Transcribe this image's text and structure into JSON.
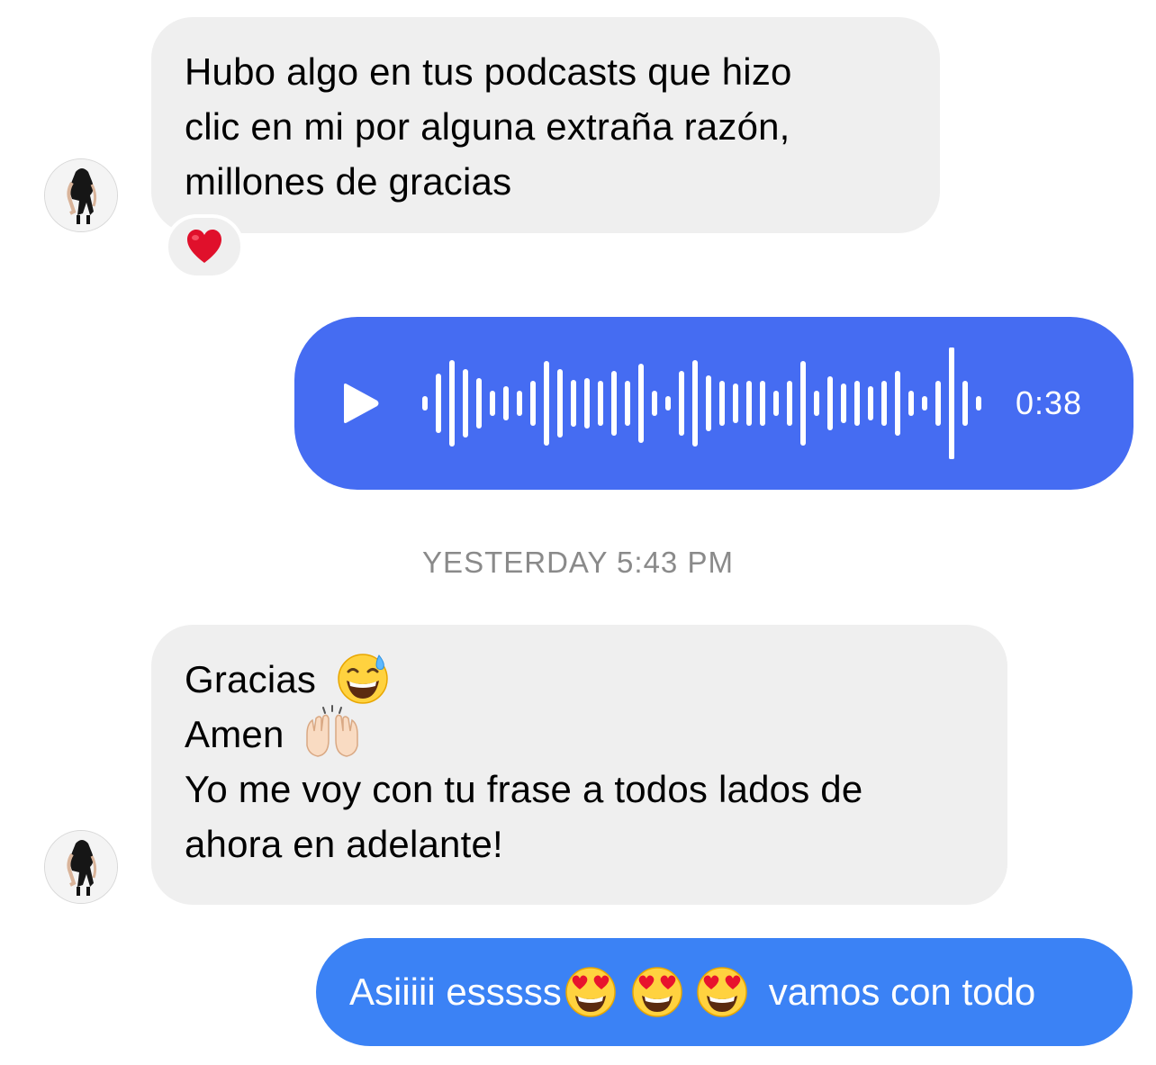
{
  "messages": [
    {
      "type": "incoming-text",
      "lines": [
        "Hubo algo en tus  podcasts que hizo",
        "clic en mi por alguna extraña razón,",
        "millones de gracias"
      ],
      "reaction": "heart"
    },
    {
      "type": "outgoing-voice",
      "duration": "0:38",
      "icon": "play-icon"
    },
    {
      "type": "incoming-text",
      "lines": [
        "Gracias",
        "Amen",
        "Yo me voy con tu frase a todos lados de",
        "ahora en adelante!"
      ],
      "emojis": [
        "grinning-sweat-emoji",
        "raised-hands-emoji"
      ]
    },
    {
      "type": "outgoing-text",
      "text_before": "Asiiiii esssss",
      "text_after": "vamos con todo",
      "emojis": [
        "heart-eyes-emoji",
        "heart-eyes-emoji",
        "heart-eyes-emoji"
      ]
    }
  ],
  "timestamp": "YESTERDAY 5:43 PM",
  "colors": {
    "incoming_bubble": "#efefef",
    "voice_bubble": "#456cf2",
    "outgoing_bubble": "#3b82f5",
    "timestamp_text": "#8a8a8a"
  }
}
